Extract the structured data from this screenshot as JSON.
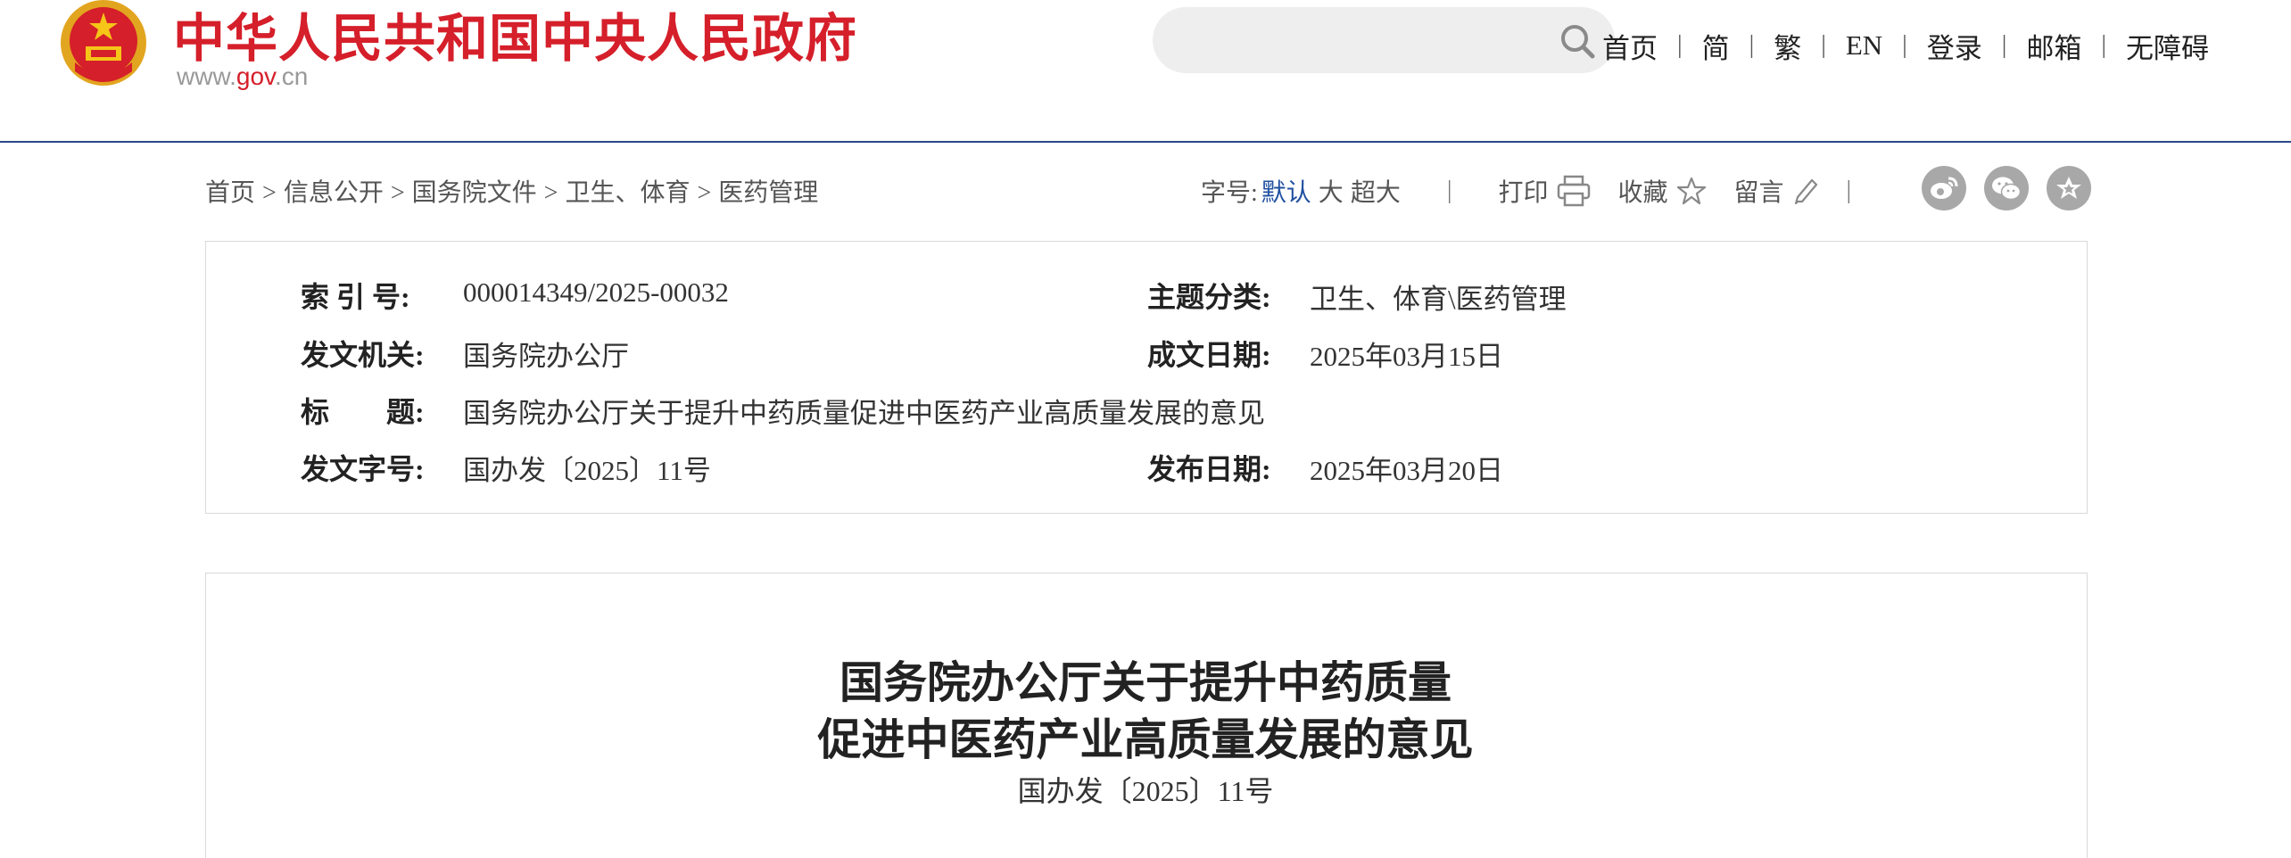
{
  "header": {
    "site_title": "中华人民共和国中央人民政府",
    "site_url_prefix": "www.",
    "site_url_gov": "gov",
    "site_url_suffix": ".cn",
    "search": {
      "placeholder": "",
      "icon": "search-icon"
    },
    "nav": [
      "首页",
      "简",
      "繁",
      "EN",
      "登录",
      "邮箱",
      "无障碍"
    ]
  },
  "breadcrumb": [
    "首页",
    "信息公开",
    "国务院文件",
    "卫生、体育",
    "医药管理"
  ],
  "tools": {
    "font_size_label": "字号:",
    "font_default": "默认",
    "font_large": "大",
    "font_xlarge": "超大",
    "print": "打印",
    "favorite": "收藏",
    "comment": "留言",
    "share_icons": [
      "weibo-icon",
      "wechat-icon",
      "favorites-star-icon"
    ]
  },
  "info": {
    "index_label": "索 引 号:",
    "index_value": "000014349/2025-00032",
    "topic_label": "主题分类:",
    "topic_value": "卫生、体育\\医药管理",
    "issuer_label": "发文机关:",
    "issuer_value": "国务院办公厅",
    "written_label": "成文日期:",
    "written_value": "2025年03月15日",
    "title_label": "标　　题:",
    "title_value": "国务院办公厅关于提升中药质量促进中医药产业高质量发展的意见",
    "docno_label": "发文字号:",
    "docno_value": "国办发〔2025〕11号",
    "published_label": "发布日期:",
    "published_value": "2025年03月20日"
  },
  "article": {
    "title_line1": "国务院办公厅关于提升中药质量",
    "title_line2": "促进中医药产业高质量发展的意见",
    "doc_number": "国办发〔2025〕11号"
  },
  "colors": {
    "brand_red": "#d51f2a",
    "accent_blue": "#1f4fa0",
    "divider_navy": "#2a4a8a"
  }
}
